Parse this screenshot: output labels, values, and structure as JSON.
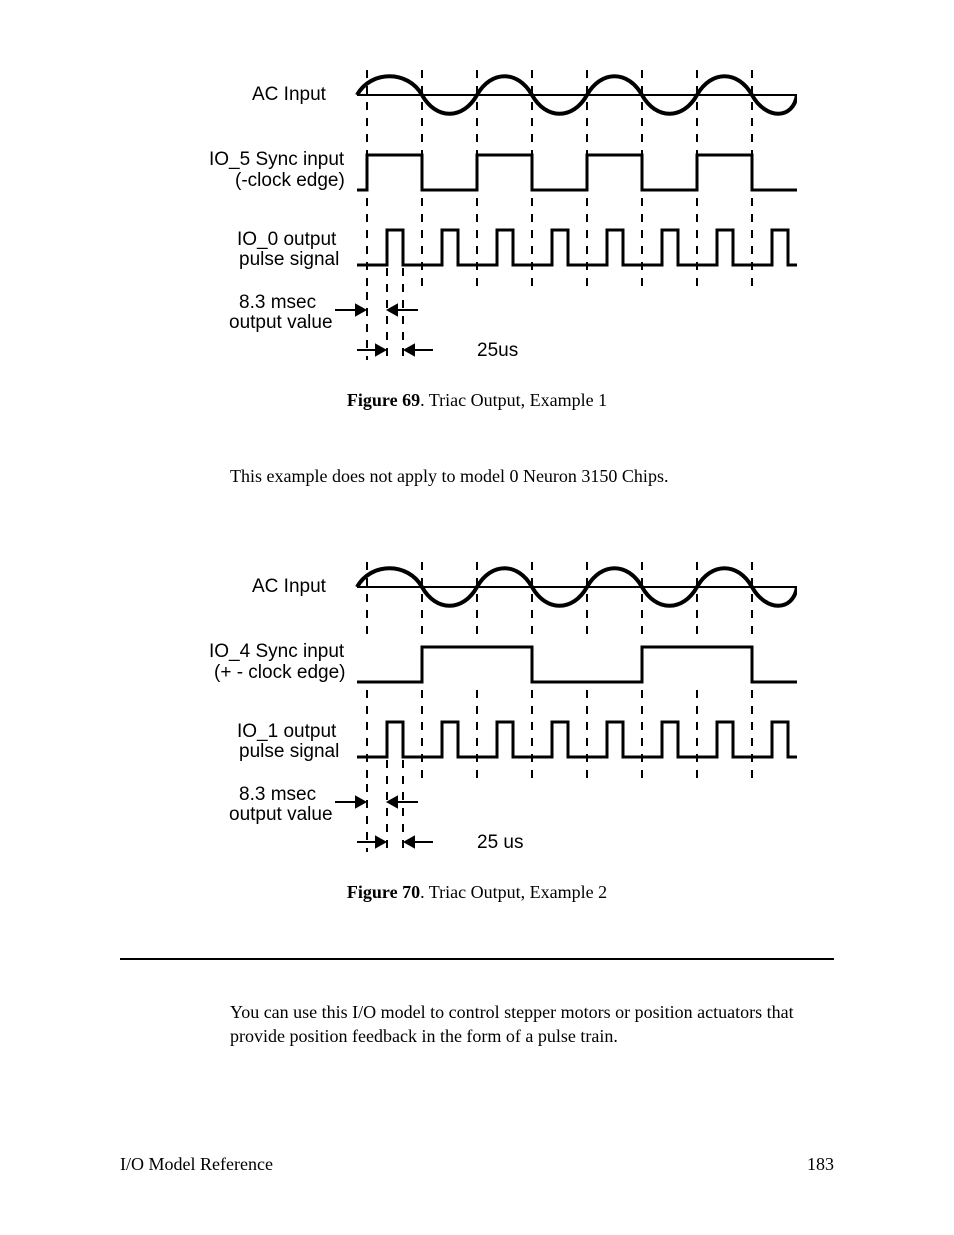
{
  "figure1": {
    "labels": {
      "ac": "AC Input",
      "sync": "IO_5 Sync input\n(-clock edge)",
      "out1": "IO_0 output",
      "out2": "pulse signal",
      "ms1": "8.3 msec",
      "ms2": "output value",
      "us": "25us"
    },
    "caption_bold": "Figure 69",
    "caption_rest": ". Triac Output, Example 1"
  },
  "mid_paragraph": "This example does not apply to model 0 Neuron 3150 Chips.",
  "figure2": {
    "labels": {
      "ac": "AC Input",
      "sync": "IO_4 Sync input\n(+ - clock edge)",
      "out1": "IO_1 output",
      "out2": "pulse signal",
      "ms1": "8.3 msec",
      "ms2": "output value",
      "us": "25 us"
    },
    "caption_bold": "Figure 70",
    "caption_rest": ". Triac Output, Example 2"
  },
  "body_paragraph": "You can use this I/O model to control stepper motors or position actuators that provide position feedback in the form of a pulse train.",
  "footer_left": "I/O Model Reference",
  "footer_right": "183"
}
